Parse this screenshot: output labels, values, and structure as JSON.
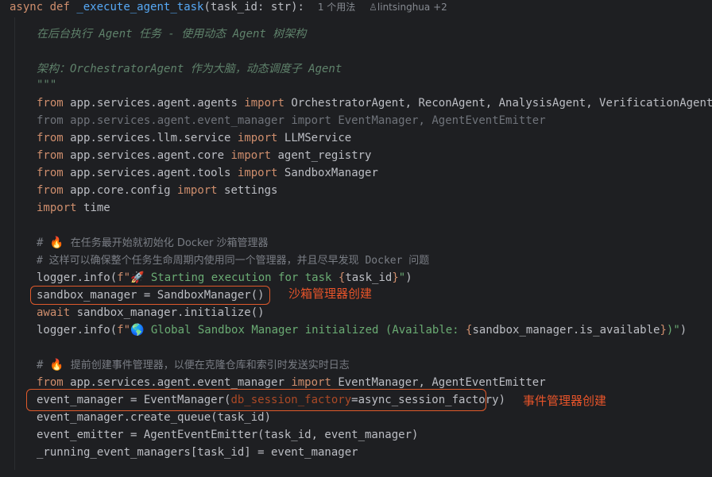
{
  "header": {
    "kw_async": "async",
    "kw_def": "def",
    "func_name": "_execute_agent_task",
    "open_paren": "(",
    "param": "task_id",
    "colon": ":",
    "type": "str",
    "close": "):",
    "usage": "1 个用法",
    "author_icon": "person-icon",
    "author": "lintsinghua +2"
  },
  "docstring": {
    "line1": "在后台执行 Agent 任务 - 使用动态 Agent 树架构",
    "line2": "架构：OrchestratorAgent 作为大脑，动态调度子 Agent",
    "close": "\"\"\""
  },
  "imports": [
    {
      "kw1": "from",
      "module": "app.services.agent.agents",
      "kw2": "import",
      "names": "OrchestratorAgent, ReconAgent, AnalysisAgent, VerificationAgent"
    },
    {
      "kw1": "from",
      "module": "app.services.agent.event_manager",
      "kw2": "import",
      "names": "EventManager, AgentEventEmitter"
    },
    {
      "kw1": "from",
      "module": "app.services.llm.service",
      "kw2": "import",
      "names": "LLMService"
    },
    {
      "kw1": "from",
      "module": "app.services.agent.core",
      "kw2": "import",
      "names": "agent_registry"
    },
    {
      "kw1": "from",
      "module": "app.services.agent.tools",
      "kw2": "import",
      "names": "SandboxManager"
    },
    {
      "kw1": "from",
      "module": "app.core.config",
      "kw2": "import",
      "names": "settings"
    }
  ],
  "import_time": {
    "kw": "import",
    "name": "time"
  },
  "sandbox_block": {
    "comment1_hash": "#",
    "comment1_emoji": "🔥",
    "comment1_text": "在任务最开始就初始化 Docker 沙箱管理器",
    "comment2": "# 这样可以确保整个任务生命周期内使用同一个管理器，并且尽早发现 Docker 问题",
    "log1_call": "logger.info(",
    "log1_prefix": "f\"",
    "log1_emoji": "🚀",
    "log1_text": " Starting execution for task ",
    "log1_lbrace": "{",
    "log1_var": "task_id",
    "log1_rbrace": "}",
    "log1_end_quote": "\"",
    "log1_close": ")",
    "assign": "sandbox_manager = SandboxManager()",
    "await_kw": "await",
    "await_rest": " sandbox_manager.initialize()",
    "log2_call": "logger.info(",
    "log2_prefix": "f\"",
    "log2_emoji": "🌎",
    "log2_text": " Global Sandbox Manager initialized (Available: ",
    "log2_lbrace": "{",
    "log2_var": "sandbox_manager.is_available",
    "log2_rbrace": "}",
    "log2_text2": ")\"",
    "log2_close": ")"
  },
  "event_block": {
    "comment_hash": "#",
    "comment_emoji": "🔥",
    "comment_text": "提前创建事件管理器，以便在克隆仓库和索引时发送实时日志",
    "import_kw1": "from",
    "import_module": "app.services.agent.event_manager",
    "import_kw2": "import",
    "import_names": "EventManager, AgentEventEmitter",
    "assign_lhs": "event_manager = EventManager(",
    "assign_param": "db_session_factory",
    "assign_rhs": "=async_session_factory)",
    "create_queue": "event_manager.create_queue(task_id)",
    "emitter": "event_emitter = AgentEventEmitter(task_id, event_manager)",
    "running": "_running_event_managers[task_id] = event_manager"
  },
  "annotations": {
    "sandbox": "沙箱管理器创建",
    "event": "事件管理器创建",
    "color": "#e8542a"
  }
}
